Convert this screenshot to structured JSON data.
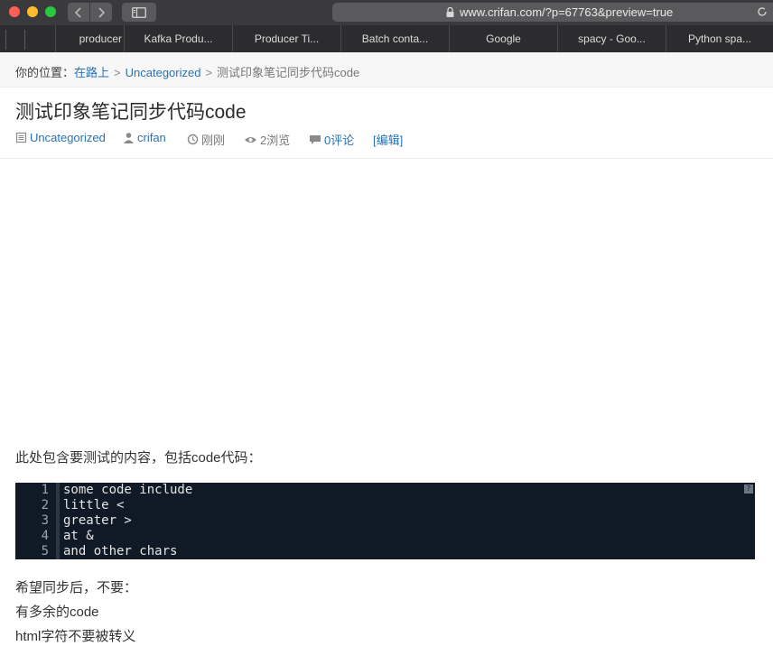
{
  "browser": {
    "url": "www.crifan.com/?p=67763&preview=true",
    "tabs": [
      "producer",
      "Kafka Produ...",
      "Producer Ti...",
      "Batch conta...",
      "Google",
      "spacy - Goo...",
      "Python spa..."
    ],
    "icons": {
      "back": "chevron-left-icon",
      "forward": "chevron-right-icon",
      "sidebar": "sidebar-icon",
      "lock": "lock-icon"
    }
  },
  "breadcrumb": {
    "label": "你的位置：",
    "home": "在路上",
    "category": "Uncategorized",
    "current": "测试印象笔记同步代码code",
    "separator": ">"
  },
  "post": {
    "title": "测试印象笔记同步代码code",
    "meta": {
      "category": "Uncategorized",
      "author": "crifan",
      "time": "刚刚",
      "views": "2浏览",
      "comments": "0评论",
      "edit": "[编辑]"
    },
    "intro": "此处包含要测试的内容，包括code代码：",
    "code": {
      "line_numbers": [
        "1",
        "2",
        "3",
        "4",
        "5"
      ],
      "lines": [
        "some code include",
        "little <",
        "greater >",
        "at &",
        "and other chars"
      ],
      "help": "?"
    },
    "after": [
      "希望同步后，不要：",
      "有多余的code",
      "html字符不要被转义"
    ]
  },
  "colors": {
    "link": "#2a72b5",
    "code_bg": "#0f1a26",
    "titlebar": "#3a3a3c"
  }
}
